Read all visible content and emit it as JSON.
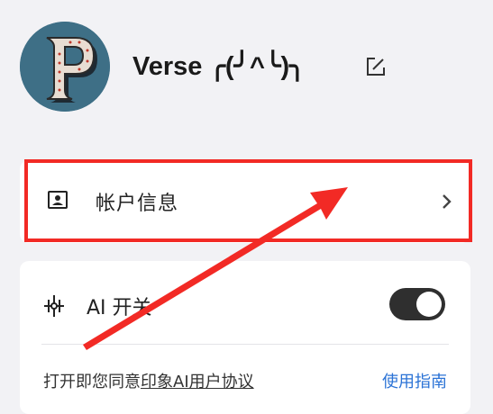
{
  "profile": {
    "name": "Verse ╭(╯^╰)╮",
    "avatar_letter": "P",
    "edit_icon": "edit-icon"
  },
  "account": {
    "label": "帐户信息",
    "icon": "id-card-icon",
    "chevron": "chevron-right-icon"
  },
  "ai": {
    "label": "AI 开关",
    "icon": "sparkle-icon",
    "toggle_on": true
  },
  "agreement": {
    "prefix": "打开即您同意",
    "link_text": "印象AI用户协议",
    "guide_text": "使用指南"
  },
  "colors": {
    "background": "#f2f2f5",
    "highlight": "#f22a25",
    "link": "#2b73d6",
    "avatar_bg": "#3e6f86"
  }
}
